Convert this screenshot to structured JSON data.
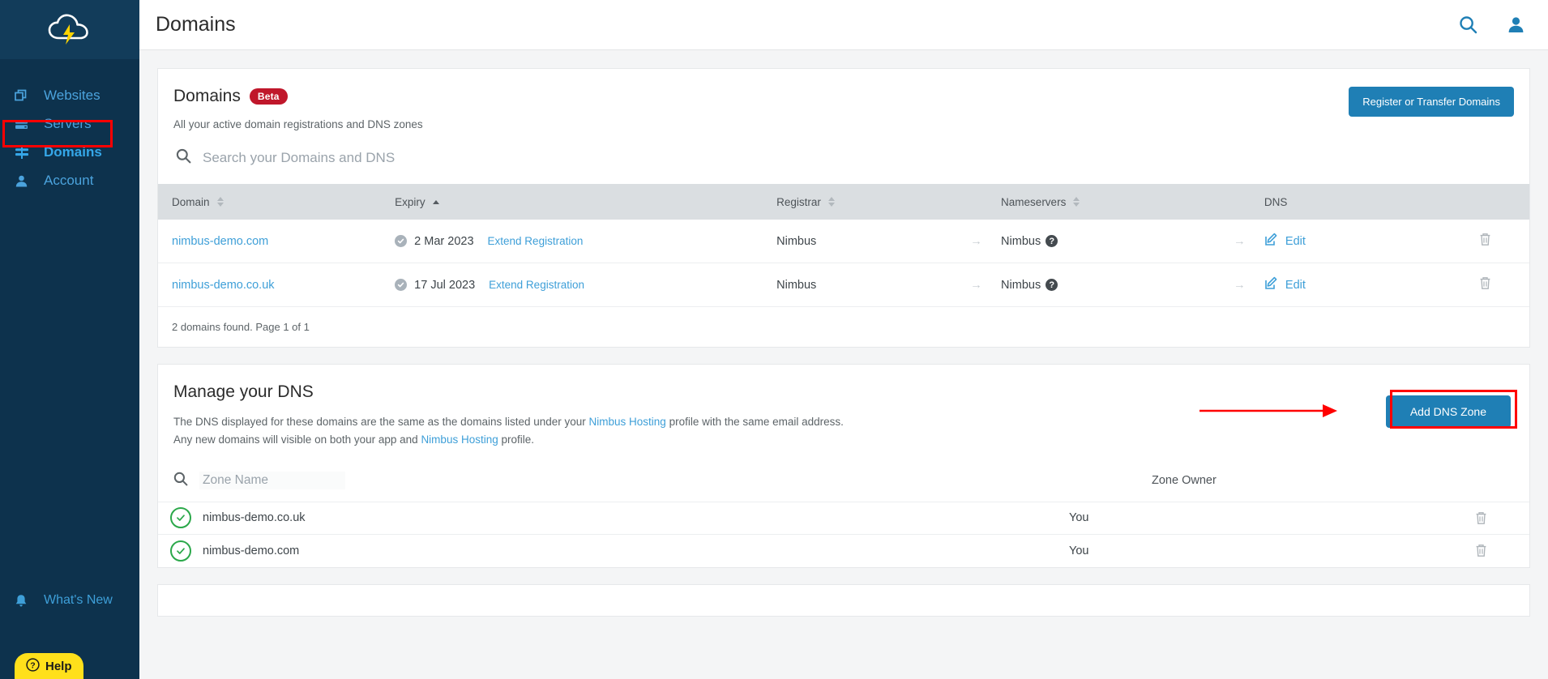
{
  "sidebar": {
    "logo_name": "nimbus-cloud-logo",
    "items": [
      {
        "label": "Websites",
        "icon": "windows-icon",
        "active": false
      },
      {
        "label": "Servers",
        "icon": "server-icon",
        "active": false
      },
      {
        "label": "Domains",
        "icon": "signpost-icon",
        "active": true
      },
      {
        "label": "Account",
        "icon": "person-icon",
        "active": false
      }
    ],
    "whats_new": {
      "label": "What's New",
      "icon": "bell-icon"
    },
    "help": {
      "label": "Help",
      "icon": "question-circle-icon"
    }
  },
  "topbar": {
    "title": "Domains",
    "search_icon": "search-icon",
    "account_icon": "person-icon"
  },
  "domains_card": {
    "title": "Domains",
    "badge": "Beta",
    "subtitle": "All your active domain registrations and DNS zones",
    "register_button": "Register or Transfer Domains",
    "search_placeholder": "Search your Domains and DNS",
    "search_value": "",
    "columns": {
      "domain": "Domain",
      "expiry": "Expiry",
      "registrar": "Registrar",
      "nameservers": "Nameservers",
      "dns": "DNS"
    },
    "sort": {
      "column": "Expiry",
      "direction": "asc"
    },
    "rows": [
      {
        "domain": "nimbus-demo.com",
        "expiry": "2 Mar 2023",
        "extend_label": "Extend Registration",
        "registrar": "Nimbus",
        "nameservers": "Nimbus",
        "dns_action": "Edit",
        "status": "verified"
      },
      {
        "domain": "nimbus-demo.co.uk",
        "expiry": "17 Jul 2023",
        "extend_label": "Extend Registration",
        "registrar": "Nimbus",
        "nameservers": "Nimbus",
        "dns_action": "Edit",
        "status": "verified"
      }
    ],
    "footer": "2 domains found. Page 1 of 1"
  },
  "dns_card": {
    "title": "Manage your DNS",
    "note_line1_a": "The DNS displayed for these domains are the same as the domains listed under your ",
    "note_link1": "Nimbus Hosting",
    "note_line1_b": " profile with the same email address.",
    "note_line2_a": "Any new domains will visible on both your app and ",
    "note_link2": "Nimbus Hosting",
    "note_line2_b": " profile.",
    "add_zone_button": "Add DNS Zone",
    "zone_search_placeholder": "Zone Name",
    "zone_search_value": "",
    "zone_owner_header": "Zone Owner",
    "zones": [
      {
        "name": "nimbus-demo.co.uk",
        "owner": "You",
        "status": "ok"
      },
      {
        "name": "nimbus-demo.com",
        "owner": "You",
        "status": "ok"
      }
    ]
  },
  "colors": {
    "sidebar_bg": "#0d324d",
    "accent_blue": "#1f7fb5",
    "link_blue": "#3e9fd8",
    "badge_red": "#c0172b",
    "annotation_red": "#ff0000",
    "zone_green": "#2ba84a",
    "help_yellow": "#ffe01b"
  }
}
